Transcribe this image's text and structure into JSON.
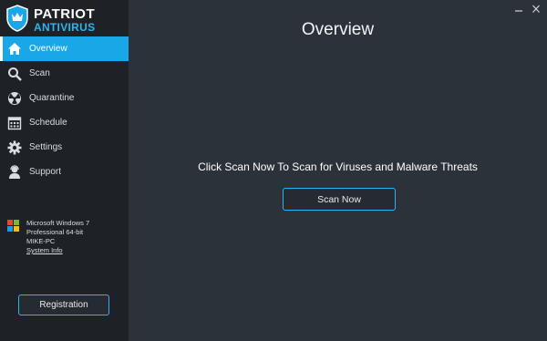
{
  "app": {
    "brand_line1": "PATRIOT",
    "brand_line2": "ANTIVIRUS"
  },
  "sidebar": {
    "items": [
      {
        "label": "Overview",
        "icon": "home-icon",
        "active": true
      },
      {
        "label": "Scan",
        "icon": "search-icon",
        "active": false
      },
      {
        "label": "Quarantine",
        "icon": "radiation-icon",
        "active": false
      },
      {
        "label": "Schedule",
        "icon": "calendar-icon",
        "active": false
      },
      {
        "label": "Settings",
        "icon": "gear-icon",
        "active": false
      },
      {
        "label": "Support",
        "icon": "user-support-icon",
        "active": false
      }
    ],
    "system": {
      "os_line1": "Microsoft Windows 7",
      "os_line2": "Professional  64-bit",
      "machine": "MIKE-PC",
      "link": "System Info"
    },
    "registration_label": "Registration"
  },
  "main": {
    "title": "Overview",
    "headline": "Click Scan Now To Scan for Viruses and Malware Threats",
    "scan_button": "Scan Now"
  },
  "colors": {
    "accent": "#1aa7e8",
    "sidebar_bg": "#1e2226",
    "main_bg": "#2c3239"
  }
}
